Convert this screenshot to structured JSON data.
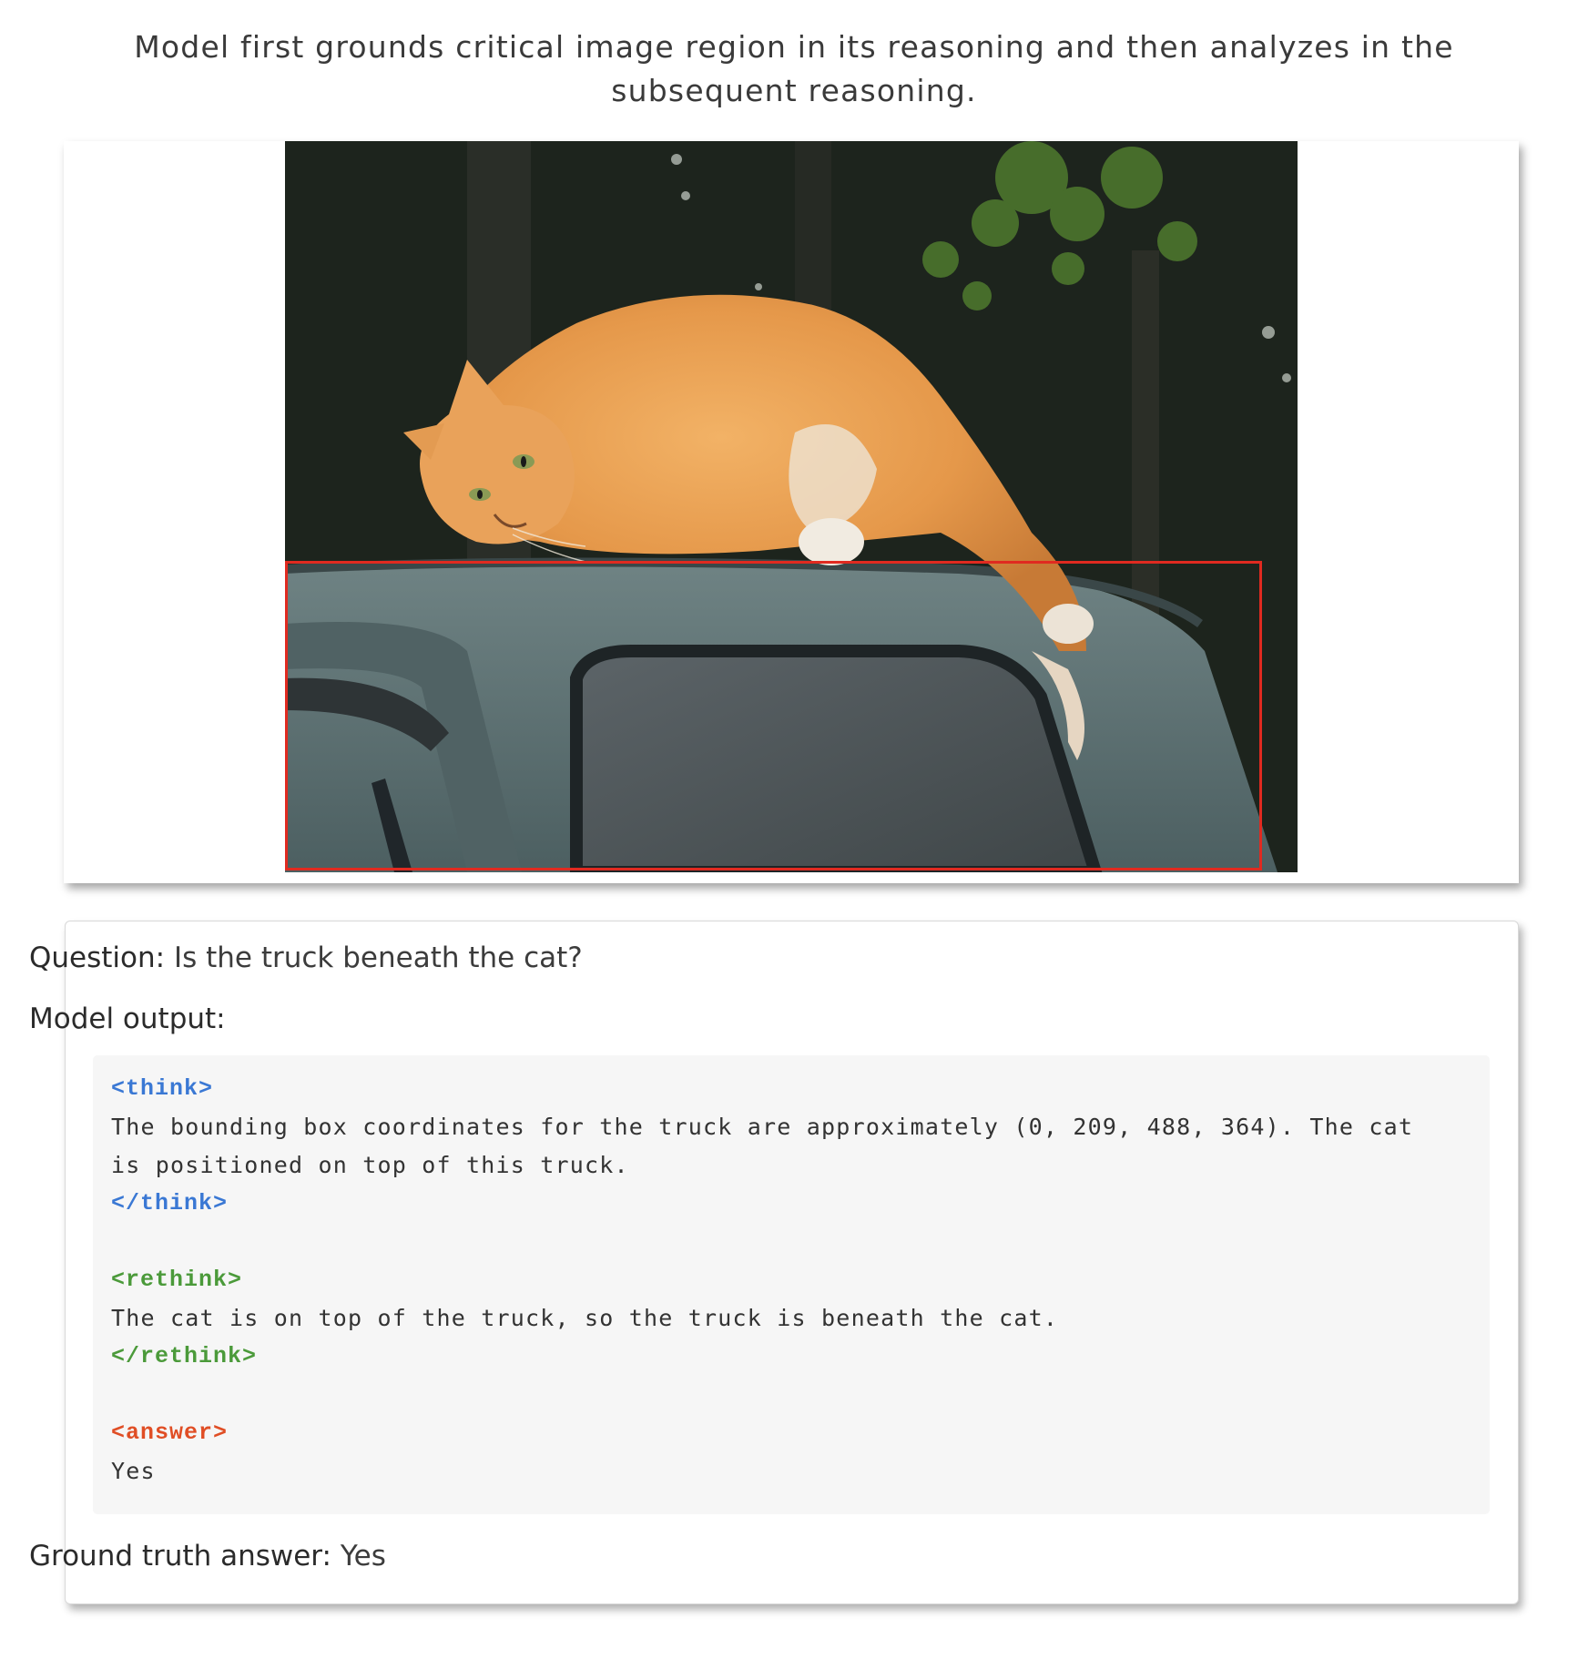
{
  "caption": "Model first grounds critical image region in its reasoning and then analyzes in the subsequent reasoning.",
  "question": {
    "label": "Question:",
    "text": "Is the truck beneath the cat?"
  },
  "model_output": {
    "label": "Model output:",
    "think_open": "<think>",
    "think_line1": "The bounding box coordinates for the truck are approximately (0, 209, 488, 364). The cat",
    "think_line2": "is positioned on top of this truck.",
    "think_close": "</think>",
    "rethink_open": "<rethink>",
    "rethink_line1": "The cat is on top of the truck, so the truck is beneath the cat.",
    "rethink_close": "</rethink>",
    "answer_open": "<answer>",
    "answer_text": "Yes"
  },
  "ground_truth": {
    "label": "Ground truth answer:",
    "text": "Yes"
  },
  "colors": {
    "think_tag": "#3a78d4",
    "rethink_tag": "#4b9a3a",
    "answer_tag": "#e04e25",
    "bbox": "#e02a20",
    "code_bg": "#f6f6f6"
  }
}
